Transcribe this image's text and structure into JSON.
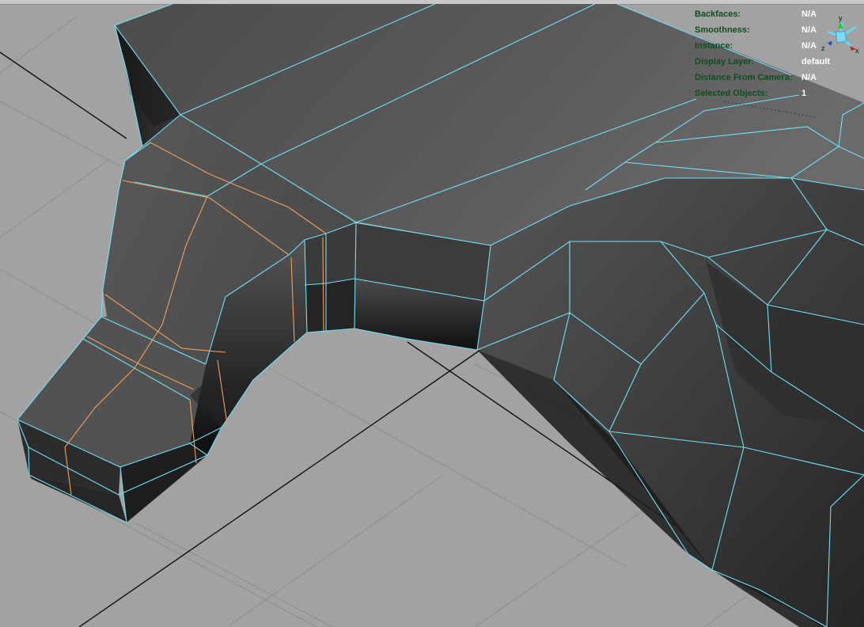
{
  "hud": {
    "rows": [
      {
        "label": "Backfaces:",
        "value": "N/A"
      },
      {
        "label": "Smoothness:",
        "value": "N/A"
      },
      {
        "label": "Instance:",
        "value": "N/A"
      },
      {
        "label": "Display Layer:",
        "value": "default"
      },
      {
        "label": "Distance From Camera:",
        "value": "N/A"
      },
      {
        "label": "Selected Objects:",
        "value": "1"
      }
    ]
  },
  "gizmo": {
    "axis_x": "x",
    "axis_y": "y",
    "axis_z": "z",
    "colors": {
      "x": "#cc2222",
      "y": "#22cc22",
      "z": "#2244cc",
      "center": "#6fd6f0"
    }
  },
  "colors": {
    "background": "#a2a2a2",
    "grid_line": "#8e8e8e",
    "grid_axis": "#111111",
    "mesh_wire": "#6fe0f4",
    "edge_loop_selected": "#f0a060",
    "mesh_face": "#4a4a4a"
  }
}
